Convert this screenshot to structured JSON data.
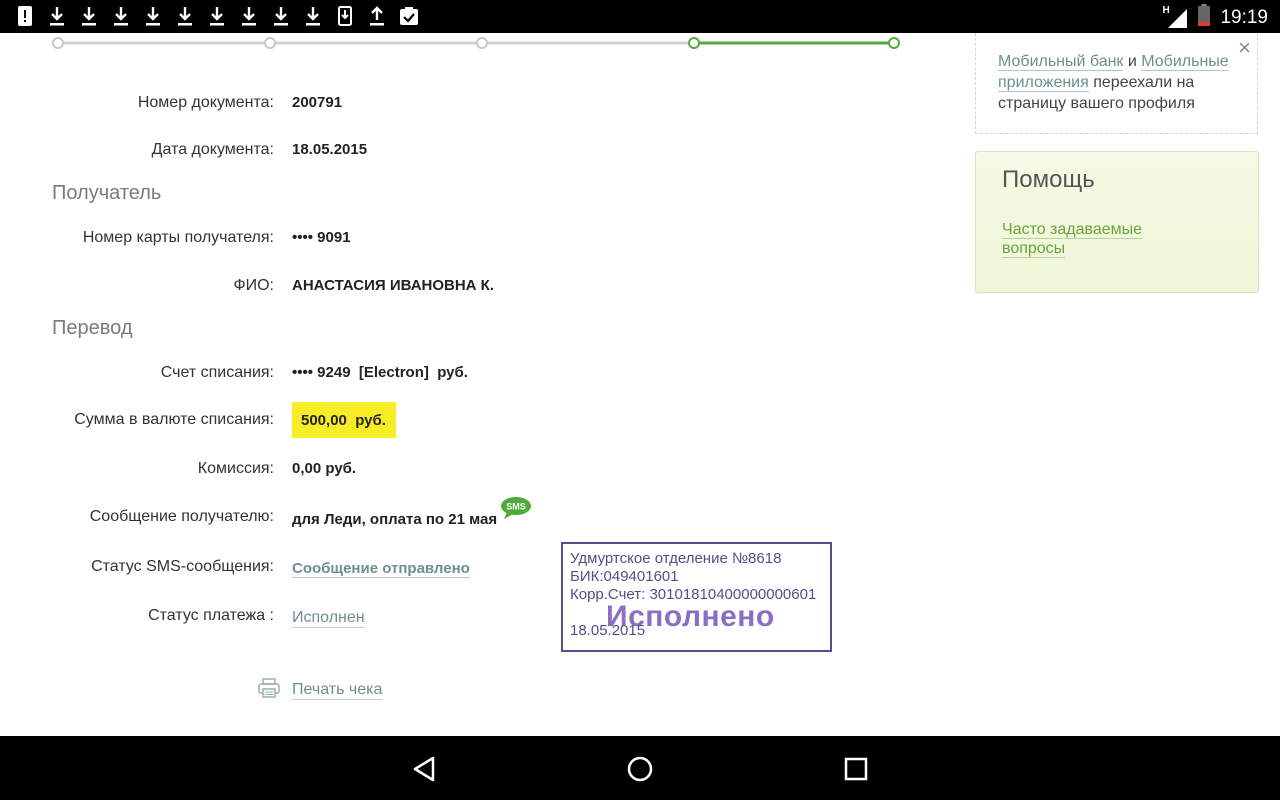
{
  "status_bar": {
    "time": "19:19",
    "network_badge": "H",
    "icons": [
      "alert-icon",
      "download-icon",
      "download-icon",
      "download-icon",
      "download-icon",
      "download-icon",
      "download-icon",
      "download-icon",
      "download-icon",
      "download-icon",
      "file-download-icon",
      "upload-icon",
      "clipboard-check-icon"
    ]
  },
  "document": {
    "number_label": "Номер документа:",
    "number_value": "200791",
    "date_label": "Дата документа:",
    "date_value": "18.05.2015"
  },
  "recipient": {
    "section_title": "Получатель",
    "card_label": "Номер карты получателя:",
    "card_value": "•••• 9091",
    "name_label": "ФИО:",
    "name_value": "АНАСТАСИЯ ИВАНОВНА К."
  },
  "transfer": {
    "section_title": "Перевод",
    "account_label": "Счет списания:",
    "account_value": "•••• 9249  [Electron]  руб.",
    "amount_label": "Сумма в валюте списания:",
    "amount_value": "500,00  руб.",
    "fee_label": "Комиссия:",
    "fee_value": "0,00 руб.",
    "message_label": "Сообщение получателю:",
    "message_value": "для Леди, оплата по 21 мая",
    "sms_badge": "SMS",
    "sms_status_label": "Статус SMS-сообщения:",
    "sms_status_value": "Сообщение отправлено",
    "payment_status_label": "Статус платежа :",
    "payment_status_value": "Исполнен"
  },
  "stamp": {
    "line1": "Удмуртское отделение №8618",
    "line2": "БИК:049401601",
    "line3": "Корр.Счет: 30101810400000000601",
    "big": "Исполнено",
    "date": "18.05.2015"
  },
  "print_label": "Печать чека",
  "notice": {
    "link1": "Мобильный банк",
    "and": " и ",
    "link2": "Мобильные приложения",
    "rest": " переехали на страницу вашего профиля",
    "close": "×"
  },
  "help": {
    "title": "Помощь",
    "faq_link": "Часто задаваемые вопросы"
  },
  "colors": {
    "accent_green": "#5aa63f",
    "highlight_yellow": "#f7ec26",
    "stamp_purple": "#5b4b8a"
  }
}
